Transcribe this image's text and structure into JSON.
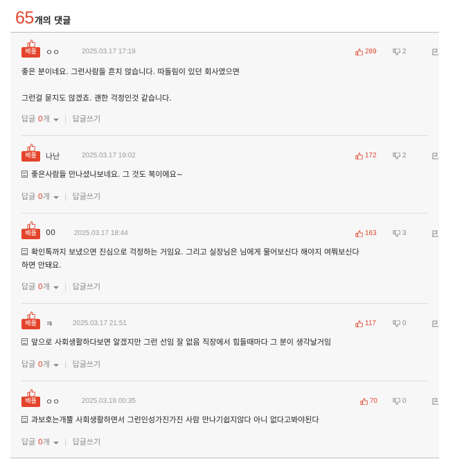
{
  "header": {
    "count": "65",
    "label": "개의 댓글"
  },
  "icons": {
    "like": "thumbs-up-icon",
    "dislike": "thumbs-down-icon",
    "report": "report-icon",
    "best": "thumbs-up-icon"
  },
  "colors": {
    "accent": "#e0452e",
    "badge": "#e4432b"
  },
  "comments": [
    {
      "badge": "베플",
      "name": "ㅇㅇ",
      "date": "2025.03.17 17:19",
      "likes": "289",
      "dislikes": "2",
      "body": "좋은 분이네요. 그런사람들 흔치 않습니다. 따돌림이 있던 회사였으면\n\n그런걸 묻지도 않겠죠. 괜한 걱정인것 같습니다.",
      "reply_label": "답글",
      "reply_count": "0",
      "reply_unit": "개",
      "write_label": "답글쓰기"
    },
    {
      "badge": "베플",
      "name": "나난",
      "date": "2025.03.17 19:02",
      "likes": "172",
      "dislikes": "2",
      "body": "좋은사람들 만나셨나보네요. 그 것도 복이에요~",
      "reply_label": "답글",
      "reply_count": "0",
      "reply_unit": "개",
      "write_label": "답글쓰기"
    },
    {
      "badge": "베플",
      "name": "00",
      "date": "2025.03.17 18:44",
      "likes": "163",
      "dislikes": "3",
      "body": "확인톡까지 보냈으면 진심으로 걱정하는 거임요. 그리고 실장님은 님에게 물어보신다 해야지 여쭤보신다\n하면 안돼요.",
      "reply_label": "답글",
      "reply_count": "0",
      "reply_unit": "개",
      "write_label": "답글쓰기"
    },
    {
      "badge": "베플",
      "name": "ㅋ",
      "date": "2025.03.17 21:51",
      "likes": "117",
      "dislikes": "0",
      "body": "앞으로 사회생활하다보면 알겠지만 그런 선임 잘 없음 직장에서 힘들때마다 그 분이 생각날거임",
      "reply_label": "답글",
      "reply_count": "0",
      "reply_unit": "개",
      "write_label": "답글쓰기"
    },
    {
      "badge": "베플",
      "name": "ㅇㅇ",
      "date": "2025.03.18 00:35",
      "likes": "70",
      "dislikes": "0",
      "body": "과보호는개뿔 사회생활하면서 그런인성가진가진 사람 만나기쉽지않다 아니 없다고봐야된다",
      "reply_label": "답글",
      "reply_count": "0",
      "reply_unit": "개",
      "write_label": "답글쓰기"
    }
  ]
}
